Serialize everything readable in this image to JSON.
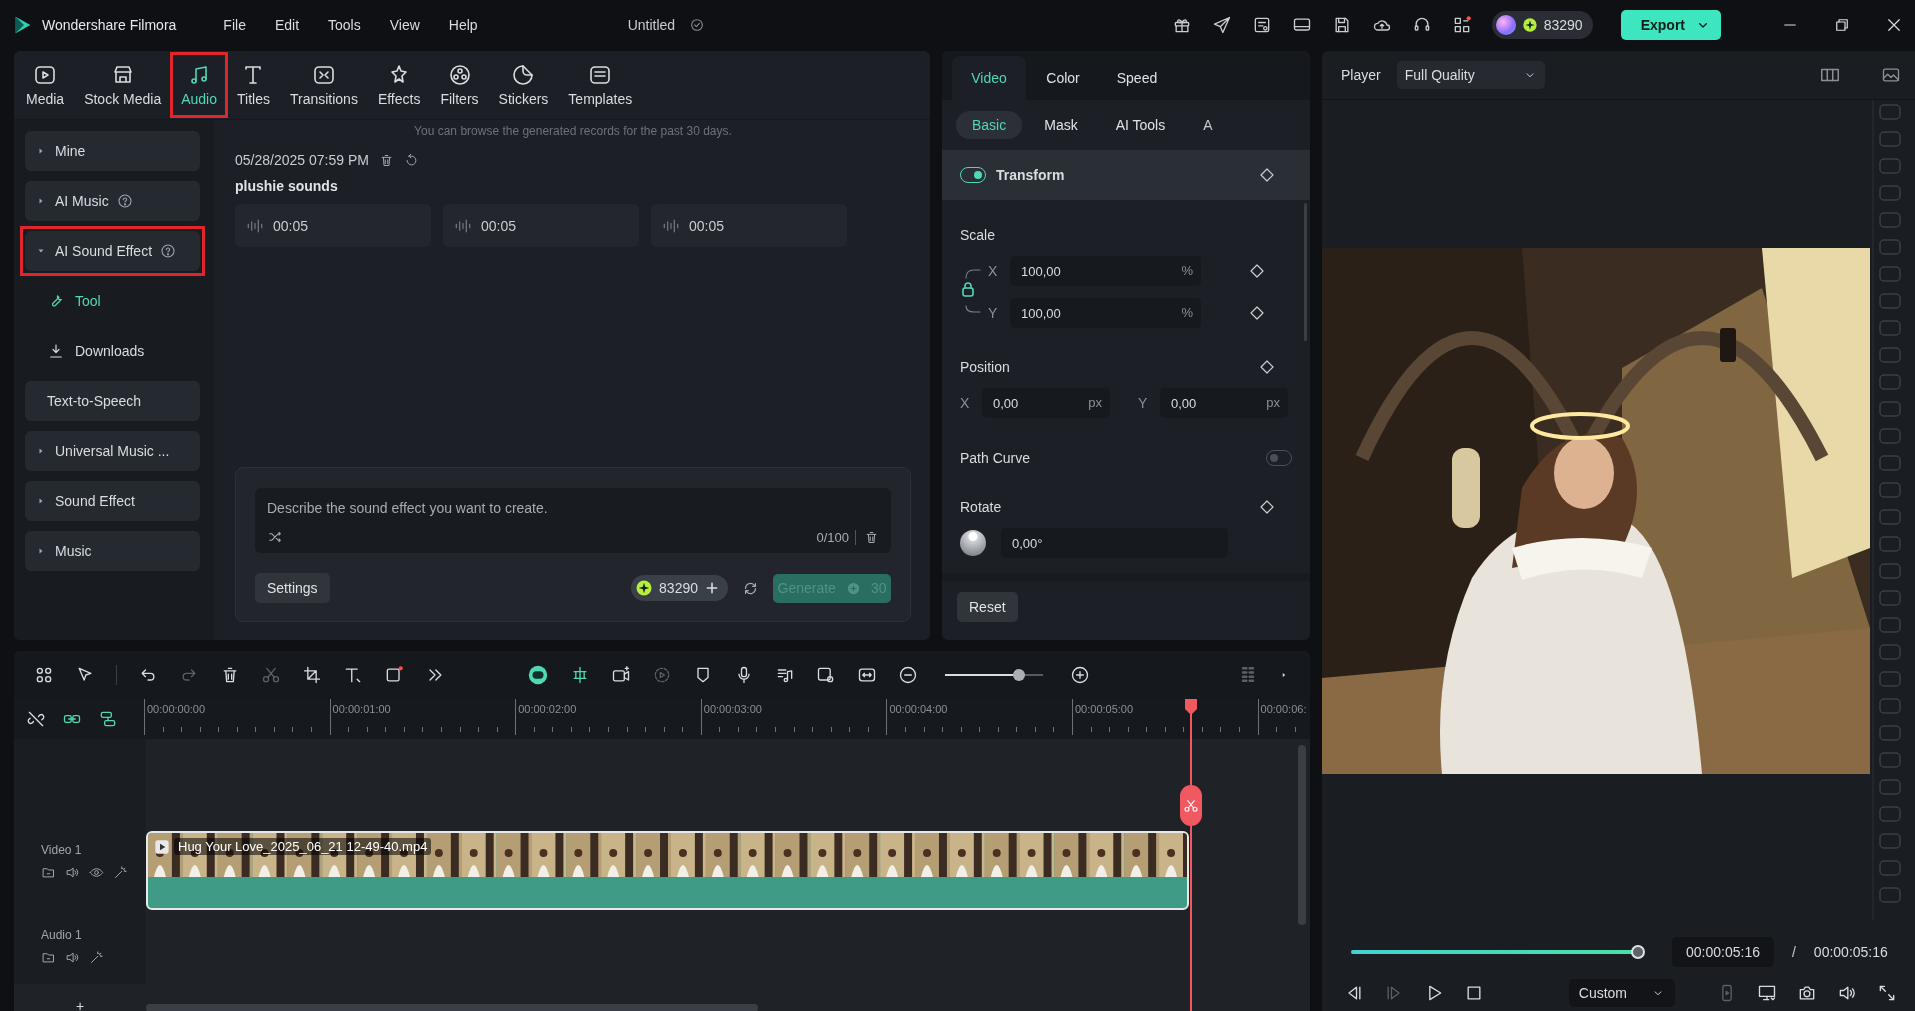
{
  "app": {
    "name": "Wondershare Filmora",
    "menu": [
      "File",
      "Edit",
      "Tools",
      "View",
      "Help"
    ],
    "project_title": "Untitled",
    "credits": "83290",
    "export_label": "Export"
  },
  "media_tabs": [
    {
      "label": "Media",
      "selected": false,
      "highlighted": false
    },
    {
      "label": "Stock Media",
      "selected": false,
      "highlighted": false
    },
    {
      "label": "Audio",
      "selected": true,
      "highlighted": true
    },
    {
      "label": "Titles",
      "selected": false,
      "highlighted": false
    },
    {
      "label": "Transitions",
      "selected": false,
      "highlighted": false
    },
    {
      "label": "Effects",
      "selected": false,
      "highlighted": false
    },
    {
      "label": "Filters",
      "selected": false,
      "highlighted": false
    },
    {
      "label": "Stickers",
      "selected": false,
      "highlighted": false
    },
    {
      "label": "Templates",
      "selected": false,
      "highlighted": false
    }
  ],
  "sidebar": [
    {
      "kind": "group",
      "label": "Mine",
      "expanded": false,
      "help": false,
      "selected": false,
      "highlighted": false
    },
    {
      "kind": "group",
      "label": "AI Music",
      "expanded": false,
      "help": true,
      "selected": false,
      "highlighted": false
    },
    {
      "kind": "group",
      "label": "AI Sound Effect",
      "expanded": true,
      "help": true,
      "selected": false,
      "highlighted": true
    },
    {
      "kind": "sub",
      "label": "Tool",
      "selected": true,
      "highlighted": false
    },
    {
      "kind": "sub",
      "label": "Downloads",
      "selected": false,
      "highlighted": false
    },
    {
      "kind": "plain",
      "label": "Text-to-Speech",
      "selected": false,
      "highlighted": false
    },
    {
      "kind": "group",
      "label": "Universal Music ...",
      "expanded": false,
      "help": false,
      "selected": false,
      "highlighted": false
    },
    {
      "kind": "group",
      "label": "Sound Effect",
      "expanded": false,
      "help": false,
      "selected": false,
      "highlighted": false
    },
    {
      "kind": "group",
      "label": "Music",
      "expanded": false,
      "help": false,
      "selected": false,
      "highlighted": false
    }
  ],
  "records": {
    "notice": "You can browse the generated records for the past 30 days.",
    "date": "05/28/2025 07:59 PM",
    "title": "plushie sounds",
    "clips": [
      {
        "duration": "00:05"
      },
      {
        "duration": "00:05"
      },
      {
        "duration": "00:05"
      }
    ]
  },
  "prompt": {
    "placeholder": "Describe the sound effect you want to create.",
    "counter": "0/100",
    "settings_label": "Settings",
    "credits": "83290",
    "generate_label": "Generate",
    "generate_cost": "30",
    "generate_disabled": true
  },
  "properties": {
    "tabs": [
      {
        "label": "Video",
        "selected": true
      },
      {
        "label": "Color",
        "selected": false
      },
      {
        "label": "Speed",
        "selected": false
      }
    ],
    "subtabs": [
      {
        "label": "Basic",
        "selected": true
      },
      {
        "label": "Mask",
        "selected": false
      },
      {
        "label": "AI Tools",
        "selected": false
      },
      {
        "label": "A",
        "selected": false
      }
    ],
    "transform": {
      "label": "Transform",
      "on": true
    },
    "scale": {
      "label": "Scale",
      "fields": [
        {
          "axis": "X",
          "value": "100,00",
          "unit": "%"
        },
        {
          "axis": "Y",
          "value": "100,00",
          "unit": "%"
        }
      ]
    },
    "position": {
      "label": "Position",
      "fields": [
        {
          "axis": "X",
          "value": "0,00",
          "unit": "px"
        },
        {
          "axis": "Y",
          "value": "0,00",
          "unit": "px"
        }
      ]
    },
    "path_curve": {
      "label": "Path Curve",
      "on": false
    },
    "rotate": {
      "label": "Rotate",
      "value": "0,00°"
    },
    "reset_label": "Reset"
  },
  "player": {
    "label": "Player",
    "quality": "Full Quality",
    "progress": {
      "level": 1
    },
    "current_time": "00:00:05:16",
    "separator": "/",
    "total_time": "00:00:05:16",
    "zoom": "Custom",
    "transport": [
      {
        "disabled": false
      },
      {
        "disabled": true
      },
      {
        "disabled": false
      },
      {
        "disabled": false
      }
    ],
    "view_controls": [
      {
        "disabled": true
      },
      {
        "disabled": false
      },
      {
        "disabled": false
      },
      {
        "disabled": false
      },
      {
        "disabled": false
      }
    ]
  },
  "timeline": {
    "tools": [
      {
        "disabled": false,
        "active": false
      },
      {
        "disabled": false,
        "active": false
      },
      {
        "disabled": false,
        "active": false
      },
      {
        "disabled": true,
        "active": false
      },
      {
        "disabled": false,
        "active": false
      },
      {
        "disabled": true,
        "active": false
      },
      {
        "disabled": false,
        "active": false
      },
      {
        "disabled": false,
        "active": false
      },
      {
        "disabled": false,
        "active": false
      },
      {
        "disabled": false,
        "active": false
      },
      {
        "disabled": false,
        "active": true
      },
      {
        "disabled": false,
        "active": true
      },
      {
        "disabled": false,
        "active": false
      },
      {
        "disabled": true,
        "active": false
      },
      {
        "disabled": false,
        "active": false
      },
      {
        "disabled": false,
        "active": false
      },
      {
        "disabled": false,
        "active": false
      },
      {
        "disabled": false,
        "active": false
      },
      {
        "disabled": false,
        "active": false
      }
    ],
    "zoom": {
      "level": 0.75
    },
    "link_tools": [
      {
        "active": false
      },
      {
        "active": true
      },
      {
        "active": true
      }
    ],
    "ruler": [
      "00:00:00:00",
      "00:00:01:00",
      "00:00:02:00",
      "00:00:03:00",
      "00:00:04:00",
      "00:00:05:00",
      "00:00:06:"
    ],
    "tracks": [
      {
        "kind": "video",
        "name": "Video 1",
        "clip": "Hug Your Love_2025_06_21 12-49-40.mp4"
      },
      {
        "kind": "audio",
        "name": "Audio 1"
      }
    ],
    "add_track": "+"
  }
}
